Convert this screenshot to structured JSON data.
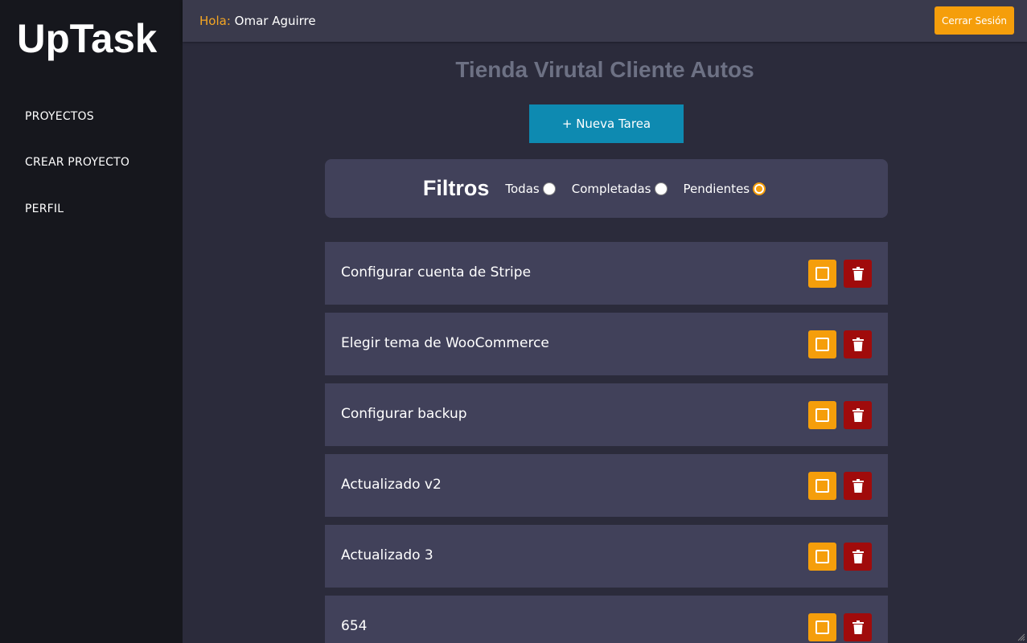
{
  "sidebar": {
    "logo": "UpTask",
    "items": [
      {
        "label": "PROYECTOS"
      },
      {
        "label": "CREAR PROYECTO"
      },
      {
        "label": "PERFIL"
      }
    ]
  },
  "header": {
    "greeting_prefix": "Hola:",
    "user_name": "Omar Aguirre",
    "logout_label": "Cerrar Sesión"
  },
  "main": {
    "project_title": "Tienda Virutal Cliente Autos",
    "new_task_label": "+ Nueva Tarea",
    "filters": {
      "title": "Filtros",
      "options": [
        {
          "label": "Todas",
          "checked": false
        },
        {
          "label": "Completadas",
          "checked": false
        },
        {
          "label": "Pendientes",
          "checked": true
        }
      ]
    },
    "tasks": [
      {
        "name": "Configurar cuenta de Stripe"
      },
      {
        "name": "Elegir tema de WooCommerce"
      },
      {
        "name": "Configurar backup"
      },
      {
        "name": "Actualizado v2"
      },
      {
        "name": "Actualizado 3"
      },
      {
        "name": "654"
      }
    ]
  },
  "colors": {
    "accent": "#f59e0b",
    "primary_button": "#0e8ab1",
    "danger": "#a00b0b",
    "sidebar_bg": "#16171d",
    "card_bg": "#41415a"
  },
  "icons": {
    "complete": "checkbox-square-icon",
    "delete": "trash-icon"
  }
}
